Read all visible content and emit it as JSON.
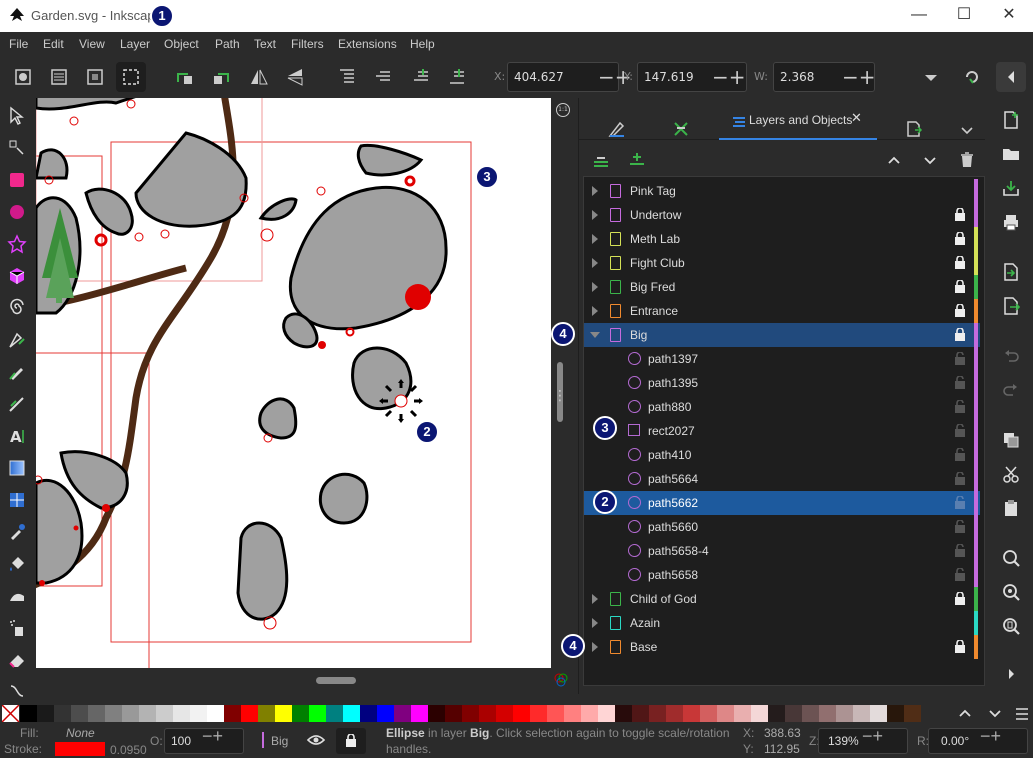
{
  "window": {
    "title": "Garden.svg - Inkscape"
  },
  "menu": [
    "File",
    "Edit",
    "View",
    "Layer",
    "Object",
    "Path",
    "Text",
    "Filters",
    "Extensions",
    "Help"
  ],
  "coords": {
    "x_label": "X:",
    "x": "404.627",
    "y_label": "Y:",
    "y": "147.619",
    "w_label": "W:",
    "w": "2.368"
  },
  "panel": {
    "active_tab": "Layers and Objects"
  },
  "layers": [
    {
      "label": "Pink Tag",
      "kind": "layer",
      "color": "#c56bde",
      "locked": false,
      "expanded": false
    },
    {
      "label": "Undertow",
      "kind": "layer",
      "color": "#c56bde",
      "locked": true,
      "expanded": false
    },
    {
      "label": "Meth Lab",
      "kind": "layer",
      "color": "#d4e157",
      "locked": true,
      "expanded": false
    },
    {
      "label": "Fight Club",
      "kind": "layer",
      "color": "#d4e157",
      "locked": true,
      "expanded": false
    },
    {
      "label": "Big Fred",
      "kind": "layer",
      "color": "#3bb44a",
      "locked": true,
      "expanded": false
    },
    {
      "label": "Entrance",
      "kind": "layer",
      "color": "#f08a2e",
      "locked": true,
      "expanded": false
    },
    {
      "label": "Big",
      "kind": "layer",
      "color": "#c56bde",
      "locked": true,
      "expanded": true
    },
    {
      "label": "path1397",
      "kind": "ellipse",
      "color": "#c56bde",
      "locked": false
    },
    {
      "label": "path1395",
      "kind": "ellipse",
      "color": "#c56bde",
      "locked": false
    },
    {
      "label": "path880",
      "kind": "ellipse",
      "color": "#c56bde",
      "locked": false
    },
    {
      "label": "rect2027",
      "kind": "rect",
      "color": "#c56bde",
      "locked": false
    },
    {
      "label": "path410",
      "kind": "ellipse",
      "color": "#c56bde",
      "locked": false
    },
    {
      "label": "path5664",
      "kind": "ellipse",
      "color": "#c56bde",
      "locked": false
    },
    {
      "label": "path5662",
      "kind": "ellipse",
      "color": "#c56bde",
      "locked": false,
      "selected": true
    },
    {
      "label": "path5660",
      "kind": "ellipse",
      "color": "#c56bde",
      "locked": false
    },
    {
      "label": "path5658-4",
      "kind": "ellipse",
      "color": "#c56bde",
      "locked": false
    },
    {
      "label": "path5658",
      "kind": "ellipse",
      "color": "#c56bde",
      "locked": false
    },
    {
      "label": "Child of God",
      "kind": "layer",
      "color": "#3bb44a",
      "locked": true,
      "expanded": false
    },
    {
      "label": "Azain",
      "kind": "layer",
      "color": "#2bd9c4",
      "locked": false,
      "expanded": false
    },
    {
      "label": "Base",
      "kind": "layer",
      "color": "#f08a2e",
      "locked": true,
      "expanded": false
    }
  ],
  "badges": {
    "b1": "1",
    "b2": "2",
    "b3": "3",
    "b4": "4"
  },
  "status": {
    "fill_label": "Fill:",
    "fill_value": "None",
    "stroke_label": "Stroke:",
    "stroke_width": "0.0950",
    "opacity_label": "O:",
    "opacity": "100",
    "layer": "Big",
    "message_bold": "Ellipse",
    "message_mid": " in layer ",
    "message_layer": "Big",
    "message_rest": ". Click selection again to toggle scale/rotation handles.",
    "cursor_x_label": "X:",
    "cursor_x": "388.63",
    "cursor_y_label": "Y:",
    "cursor_y": "112.95",
    "zoom_label": "Z:",
    "zoom": "139%",
    "rotation_label": "R:",
    "rotation": "0.00°"
  },
  "palette_colors": [
    "#000000",
    "#1a1a1a",
    "#333333",
    "#4d4d4d",
    "#666666",
    "#808080",
    "#999999",
    "#b3b3b3",
    "#cccccc",
    "#e6e6e6",
    "#f2f2f2",
    "#ffffff",
    "#800000",
    "#ff0000",
    "#808000",
    "#ffff00",
    "#008000",
    "#00ff00",
    "#008080",
    "#00ffff",
    "#000080",
    "#0000ff",
    "#800080",
    "#ff00ff",
    "#2b0000",
    "#550000",
    "#800000",
    "#aa0000",
    "#d40000",
    "#ff0000",
    "#ff2a2a",
    "#ff5555",
    "#ff8080",
    "#ffaaaa",
    "#ffd5d5",
    "#280b0b",
    "#501616",
    "#782121",
    "#a02c2c",
    "#c83737",
    "#d35f5f",
    "#de8787",
    "#e9afaf",
    "#f4d7d7",
    "#241c1c",
    "#483737",
    "#6c5353",
    "#916f6f",
    "#ac9393",
    "#c8b7b7",
    "#e3dbdb",
    "#28170b",
    "#502d16"
  ]
}
